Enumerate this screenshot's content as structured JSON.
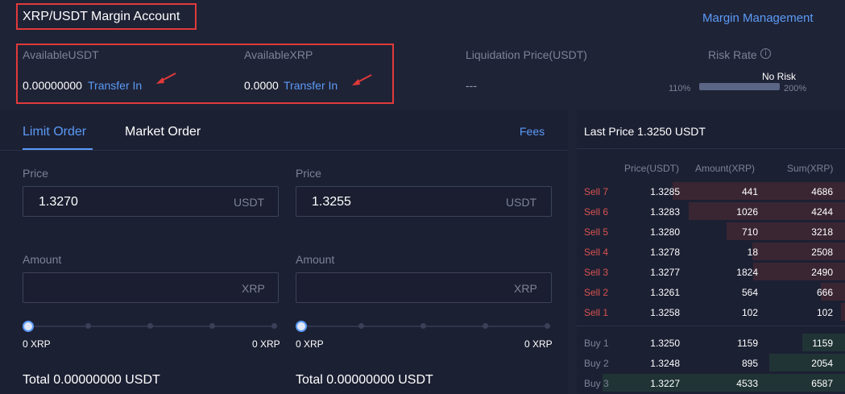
{
  "header": {
    "title": "XRP/USDT Margin Account",
    "margin_management": "Margin Management"
  },
  "balances": {
    "usdt_label": "AvailableUSDT",
    "usdt_value": "0.00000000",
    "xrp_label": "AvailableXRP",
    "xrp_value": "0.0000",
    "transfer_in": "Transfer In",
    "liquidation_label": "Liquidation Price(USDT)",
    "liquidation_value": "---",
    "risk_label": "Risk Rate",
    "risk_status": "No Risk",
    "risk_min": "110%",
    "risk_max": "200%"
  },
  "order": {
    "tab_limit": "Limit Order",
    "tab_market": "Market Order",
    "fees": "Fees",
    "price_label": "Price",
    "amount_label": "Amount",
    "buy_price": "1.3270",
    "sell_price": "1.3255",
    "usdt_unit": "USDT",
    "xrp_unit": "XRP",
    "slider_min": "0 XRP",
    "slider_max": "0 XRP",
    "total_buy": "Total 0.00000000 USDT",
    "total_sell": "Total 0.00000000 USDT"
  },
  "orderbook": {
    "last_price": "Last Price 1.3250 USDT",
    "col_price": "Price(USDT)",
    "col_amount": "Amount(XRP)",
    "col_sum": "Sum(XRP)",
    "sells": [
      {
        "label": "Sell 7",
        "price": "1.3285",
        "amount": "441",
        "sum": "4686"
      },
      {
        "label": "Sell 6",
        "price": "1.3283",
        "amount": "1026",
        "sum": "4244"
      },
      {
        "label": "Sell 5",
        "price": "1.3280",
        "amount": "710",
        "sum": "3218"
      },
      {
        "label": "Sell 4",
        "price": "1.3278",
        "amount": "18",
        "sum": "2508"
      },
      {
        "label": "Sell 3",
        "price": "1.3277",
        "amount": "1824",
        "sum": "2490"
      },
      {
        "label": "Sell 2",
        "price": "1.3261",
        "amount": "564",
        "sum": "666"
      },
      {
        "label": "Sell 1",
        "price": "1.3258",
        "amount": "102",
        "sum": "102"
      }
    ],
    "buys": [
      {
        "label": "Buy 1",
        "price": "1.3250",
        "amount": "1159",
        "sum": "1159"
      },
      {
        "label": "Buy 2",
        "price": "1.3248",
        "amount": "895",
        "sum": "2054"
      },
      {
        "label": "Buy 3",
        "price": "1.3227",
        "amount": "4533",
        "sum": "6587"
      }
    ]
  },
  "colors": {
    "accent": "#5b9bf7",
    "sell": "#d9534f",
    "highlight_border": "#e03a3a"
  }
}
